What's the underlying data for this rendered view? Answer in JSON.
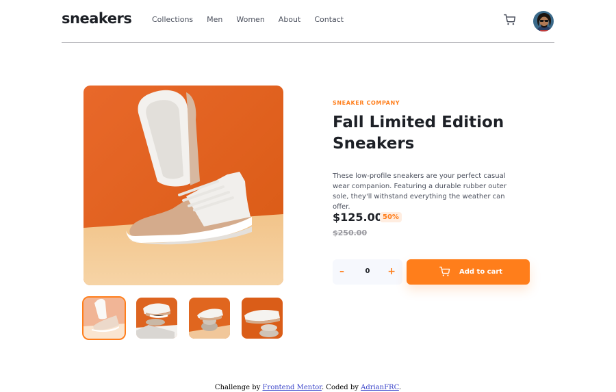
{
  "header": {
    "logo": "sneakers",
    "nav": [
      "Collections",
      "Men",
      "Women",
      "About",
      "Contact"
    ]
  },
  "product": {
    "company": "SNEAKER COMPANY",
    "title": "Fall Limited Edition Sneakers",
    "description": "These low-profile sneakers are your perfect casual wear companion. Featuring a durable rubber outer sole, they'll withstand everything the weather can offer.",
    "price": "$125.00",
    "discount": "50%",
    "old_price": "$250.00"
  },
  "cart_controls": {
    "minus": "–",
    "quantity": "0",
    "plus": "+",
    "add_label": "Add to cart"
  },
  "footer": {
    "prefix": "Challenge by ",
    "link1": "Frontend Mentor",
    "middle": ". Coded by ",
    "link2": "AdrianFRC",
    "suffix": "."
  },
  "colors": {
    "accent": "#ff7e1b",
    "accent_light": "#ffede0",
    "dark": "#1d2026",
    "text": "#4a4f5c",
    "muted": "#9a9aa0"
  },
  "icons": [
    "cart-icon",
    "avatar"
  ]
}
